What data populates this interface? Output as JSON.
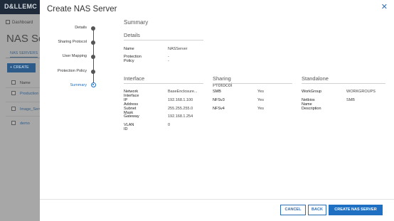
{
  "background": {
    "brand": "D&LLEMC",
    "breadcrumb": "Dashboard",
    "page_title": "NAS Servers",
    "tab": "NAS SERVERS",
    "create_button": "+ CREATE",
    "column_name": "Name",
    "rows": [
      "Production",
      "Image_Server",
      "demo"
    ]
  },
  "modal": {
    "title": "Create NAS Server",
    "close_icon": "close-icon"
  },
  "stepper": {
    "steps": [
      {
        "label": "Details",
        "active": false
      },
      {
        "label": "Sharing Protocol",
        "active": false
      },
      {
        "label": "User Mapping",
        "active": false
      },
      {
        "label": "Protection Policy",
        "active": false
      },
      {
        "label": "Summary",
        "active": true
      }
    ]
  },
  "summary": {
    "heading": "Summary",
    "details": {
      "heading": "Details",
      "name_label": "Name",
      "name_value": "NASServer",
      "policy_label": "Protection Policy",
      "policy_value": "--"
    },
    "interface": {
      "heading": "Interface",
      "rows": [
        {
          "label": "Network Interface",
          "value": "BaseEnclosure..."
        },
        {
          "label": "IP Address",
          "value": "192.168.1.100"
        },
        {
          "label": "Subnet Mask",
          "value": "255.255.255.0"
        },
        {
          "label": "Gateway",
          "value": "192.168.1.254"
        },
        {
          "label": "VLAN ID",
          "value": "0"
        }
      ]
    },
    "sharing": {
      "heading": "Sharing Protocol",
      "rows": [
        {
          "label": "SMB",
          "value": "Yes"
        },
        {
          "label": "NFSv3",
          "value": "Yes"
        },
        {
          "label": "NFSv4",
          "value": "Yes"
        }
      ]
    },
    "standalone": {
      "heading": "Standalone",
      "rows": [
        {
          "label": "WorkGroup",
          "value": "WORKGROUPS"
        },
        {
          "label": "Netbios Name",
          "value": "SMB"
        },
        {
          "label": "Description",
          "value": ""
        }
      ]
    }
  },
  "footer": {
    "cancel": "CANCEL",
    "back": "BACK",
    "create": "CREATE NAS SERVER"
  },
  "colors": {
    "accent": "#1f6fc2",
    "overlay": "#7f7f7f"
  }
}
